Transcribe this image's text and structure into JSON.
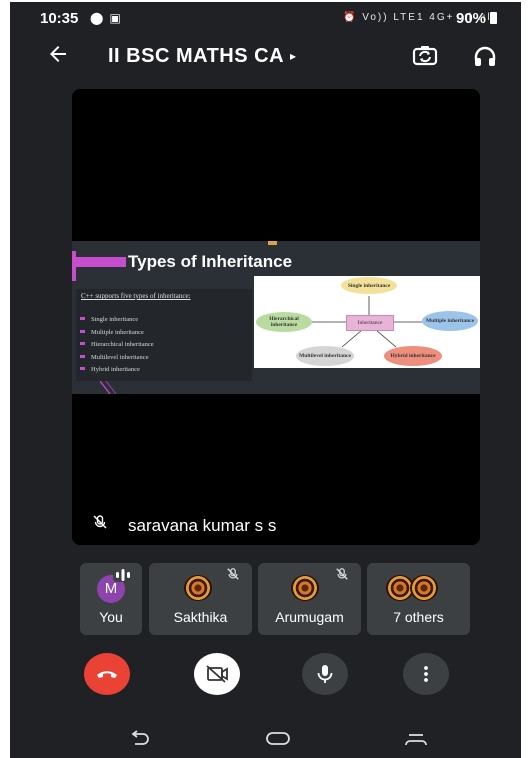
{
  "status_bar": {
    "time": "10:35",
    "network": "Vo)) LTE1 4G+ .ıl .ıl",
    "battery": "90%"
  },
  "app_bar": {
    "title": "II BSC MATHS CA",
    "title_caret": "▸"
  },
  "main_tile": {
    "presenter_name": "saravana kumar s s",
    "slide": {
      "title": "Types of Inheritance",
      "intro": "C++ supports five types of inheritance:",
      "items": [
        "Single inheritance",
        "Multiple inheritance",
        "Hierarchical inheritance",
        "Multilevel inheritance",
        "Hybrid inheritance"
      ],
      "diagram": {
        "center": "Inheritance",
        "nodes": {
          "single": "Single inheritance",
          "multiple": "Multiple inheritance",
          "hierarchical": "Hierarchical inheritance",
          "multilevel": "Multilevel inheritance",
          "hybrid": "Hybrid inheritance"
        }
      }
    }
  },
  "participants": [
    {
      "name": "You",
      "avatar_letter": "M",
      "avatar_color": "#8e44ad"
    },
    {
      "name": "Sakthika"
    },
    {
      "name": "Arumugam"
    },
    {
      "name": "7 others"
    }
  ],
  "colors": {
    "background": "#202124",
    "end_call": "#ea4335",
    "tile": "#3c4043",
    "slide_accent": "#c84dce"
  },
  "icons": {
    "back": "arrow-left",
    "camera_switch": "switch-camera",
    "audio": "headphones",
    "end_call": "phone-hangup",
    "camera_off": "video-off",
    "mic": "microphone",
    "more": "more-vertical"
  }
}
